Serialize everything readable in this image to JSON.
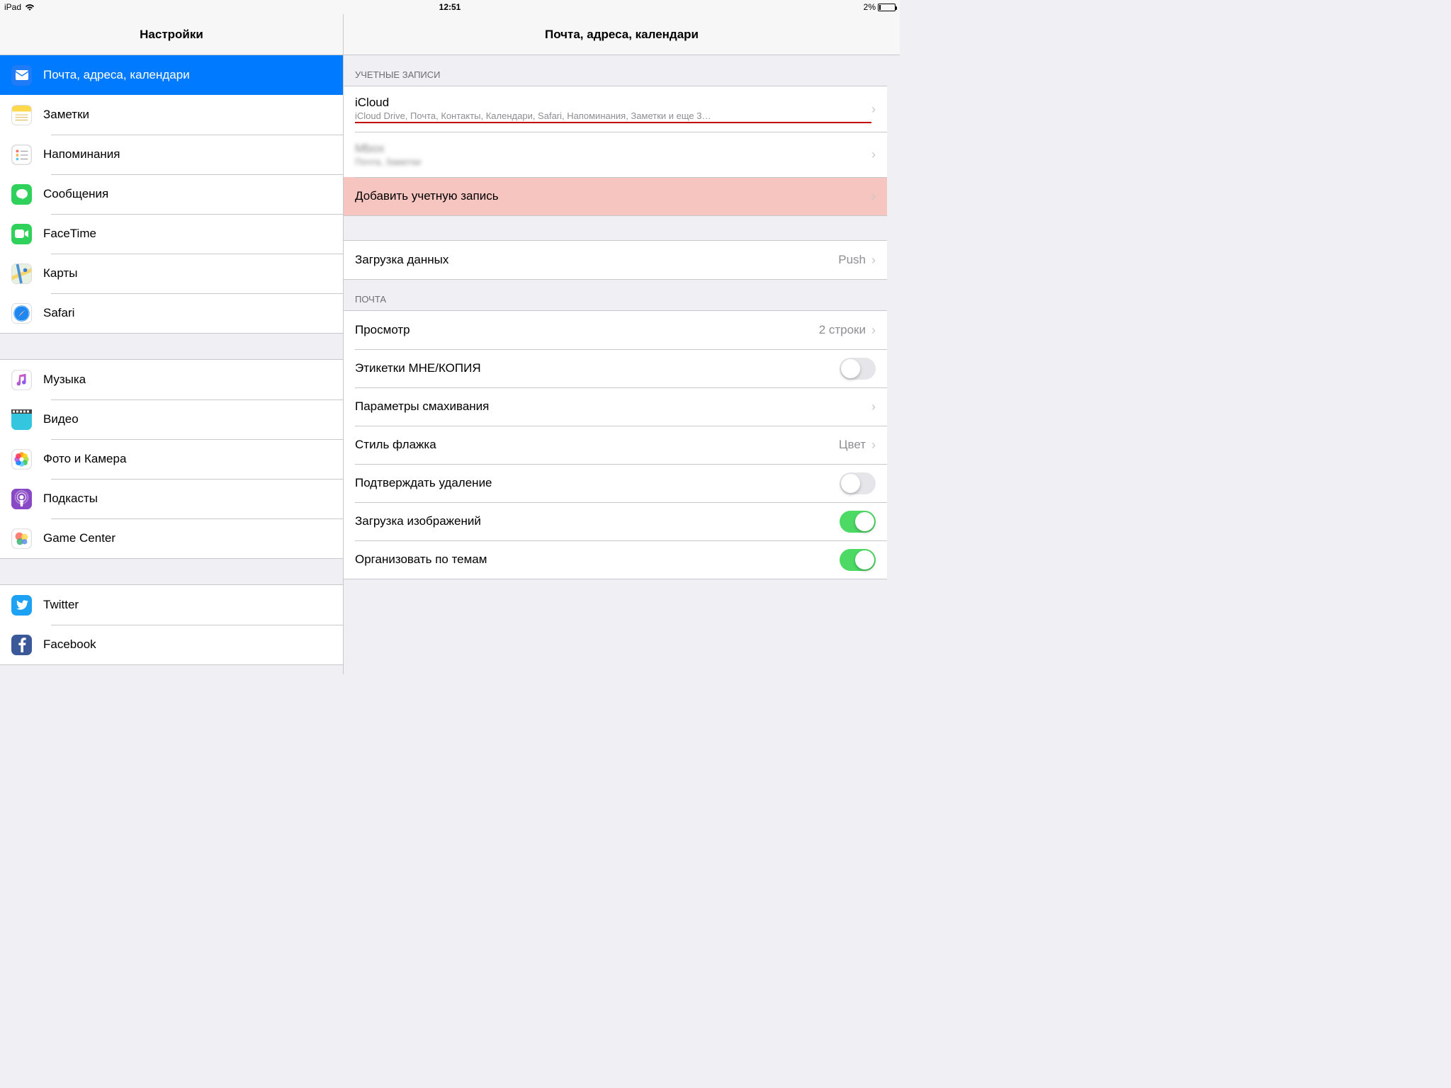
{
  "status": {
    "device": "iPad",
    "time": "12:51",
    "battery_pct": "2%"
  },
  "sidebar": {
    "title": "Настройки",
    "groups": [
      [
        {
          "label": "Почта, адреса, календари",
          "iconName": "mail-icon",
          "iconBg": "#1f7cf6",
          "selected": true
        },
        {
          "label": "Заметки",
          "iconName": "notes-icon",
          "iconBg": "#ffffff"
        },
        {
          "label": "Напоминания",
          "iconName": "reminders-icon",
          "iconBg": "#ffffff"
        },
        {
          "label": "Сообщения",
          "iconName": "messages-icon",
          "iconBg": "#2fd15a"
        },
        {
          "label": "FaceTime",
          "iconName": "facetime-icon",
          "iconBg": "#2fd15a"
        },
        {
          "label": "Карты",
          "iconName": "maps-icon",
          "iconBg": "#ffffff"
        },
        {
          "label": "Safari",
          "iconName": "safari-icon",
          "iconBg": "#ffffff"
        }
      ],
      [
        {
          "label": "Музыка",
          "iconName": "music-icon",
          "iconBg": "#ffffff"
        },
        {
          "label": "Видео",
          "iconName": "videos-icon",
          "iconBg": "#33c6de"
        },
        {
          "label": "Фото и Камера",
          "iconName": "photos-icon",
          "iconBg": "#ffffff"
        },
        {
          "label": "Подкасты",
          "iconName": "podcasts-icon",
          "iconBg": "#8948c4"
        },
        {
          "label": "Game Center",
          "iconName": "gamecenter-icon",
          "iconBg": "#ffffff"
        }
      ],
      [
        {
          "label": "Twitter",
          "iconName": "twitter-icon",
          "iconBg": "#1da1f2"
        },
        {
          "label": "Facebook",
          "iconName": "facebook-icon",
          "iconBg": "#3b5998"
        }
      ]
    ]
  },
  "detail": {
    "title": "Почта, адреса, календари",
    "accounts": {
      "header": "УЧЕТНЫЕ ЗАПИСИ",
      "items": [
        {
          "title": "iCloud",
          "sub": "iCloud Drive, Почта, Контакты, Календари, Safari, Напоминания, Заметки и еще 3…",
          "underlined": true
        },
        {
          "title": "Mbox",
          "sub": "Почта, Заметки",
          "blurred": true
        }
      ],
      "add_label": "Добавить учетную запись"
    },
    "fetch": {
      "label": "Загрузка данных",
      "value": "Push"
    },
    "mail": {
      "header": "ПОЧТА",
      "rows": [
        {
          "label": "Просмотр",
          "value": "2 строки",
          "kind": "nav"
        },
        {
          "label": "Этикетки МНЕ/КОПИЯ",
          "kind": "toggle",
          "on": false
        },
        {
          "label": "Параметры смахивания",
          "kind": "nav"
        },
        {
          "label": "Стиль флажка",
          "value": "Цвет",
          "kind": "nav"
        },
        {
          "label": "Подтверждать удаление",
          "kind": "toggle",
          "on": false
        },
        {
          "label": "Загрузка изображений",
          "kind": "toggle",
          "on": true
        },
        {
          "label": "Организовать по темам",
          "kind": "toggle",
          "on": true
        }
      ]
    }
  }
}
